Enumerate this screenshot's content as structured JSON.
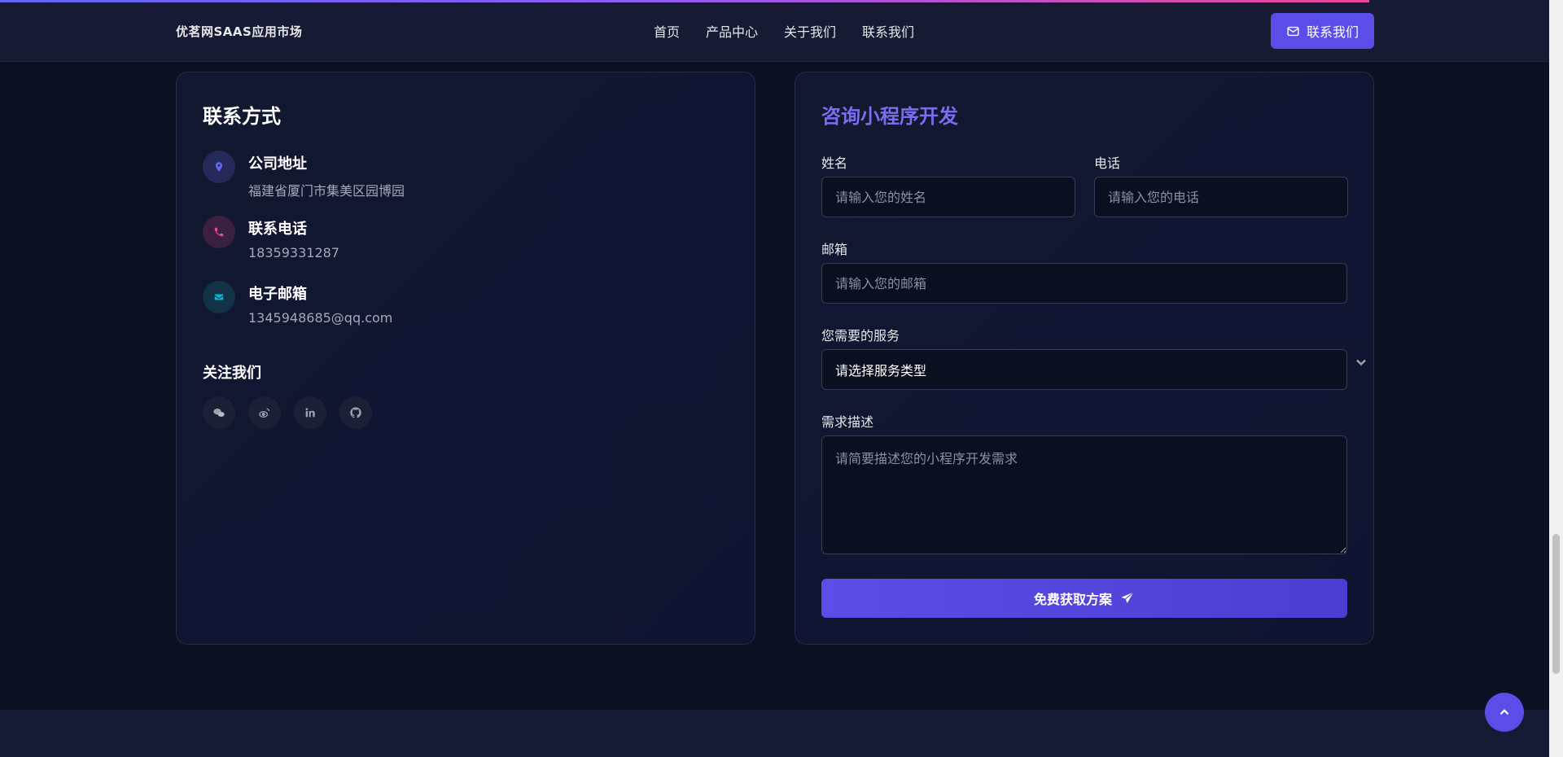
{
  "header": {
    "brand": "优茗网SAAS应用市场",
    "nav": [
      "首页",
      "产品中心",
      "关于我们",
      "联系我们"
    ],
    "cta_label": "联系我们"
  },
  "contact": {
    "title": "联系方式",
    "items": [
      {
        "label": "公司地址",
        "value": "福建省厦门市集美区园博园",
        "icon": "location-icon",
        "color": "#6366f1"
      },
      {
        "label": "联系电话",
        "value": "18359331287",
        "icon": "phone-icon",
        "color": "#ec4899"
      },
      {
        "label": "电子邮箱",
        "value": "1345948685@qq.com",
        "icon": "envelope-icon",
        "color": "#06b6d4"
      }
    ],
    "follow_title": "关注我们",
    "socials": [
      "wechat-icon",
      "weibo-icon",
      "linkedin-icon",
      "github-icon"
    ]
  },
  "form": {
    "title": "咨询小程序开发",
    "name_label": "姓名",
    "name_placeholder": "请输入您的姓名",
    "phone_label": "电话",
    "phone_placeholder": "请输入您的电话",
    "email_label": "邮箱",
    "email_placeholder": "请输入您的邮箱",
    "service_label": "您需要的服务",
    "service_selected": "请选择服务类型",
    "desc_label": "需求描述",
    "desc_placeholder": "请简要描述您的小程序开发需求",
    "submit_label": "免费获取方案"
  },
  "colors": {
    "accent": "#5b4ee8",
    "background": "#0b1022",
    "card": "#121830"
  }
}
